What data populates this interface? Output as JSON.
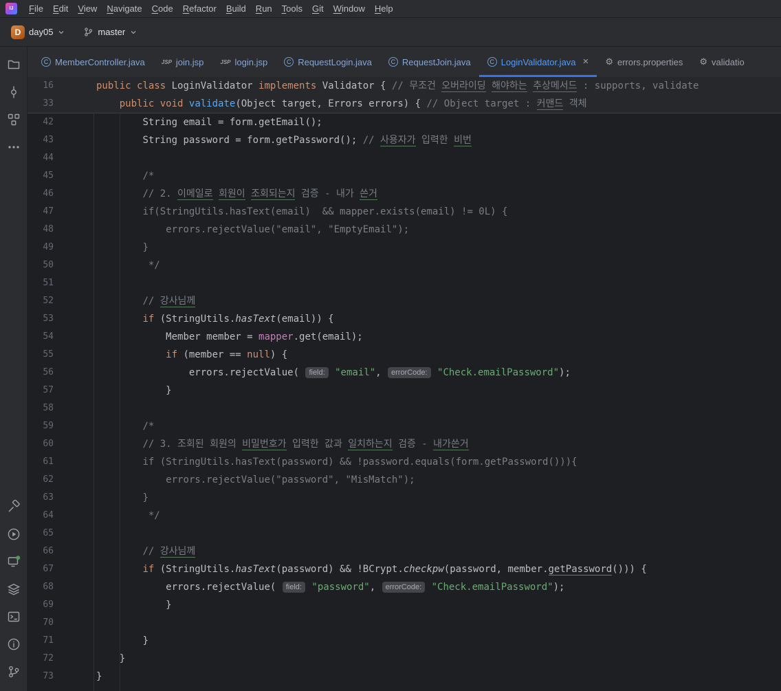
{
  "app": {
    "title": "IntelliJ IDEA",
    "logo_text": "IJ"
  },
  "colors": {
    "editor_bg": "#1e1f22",
    "panel_bg": "#2b2d30",
    "accent_blue": "#3574f0",
    "keyword": "#cf8e6d",
    "string": "#6aab73",
    "comment": "#7a7e85",
    "field": "#c77dbb",
    "method_decl": "#56a8f5",
    "typo_underline": "#567a5b"
  },
  "menu": {
    "items": [
      "File",
      "Edit",
      "View",
      "Navigate",
      "Code",
      "Refactor",
      "Build",
      "Run",
      "Tools",
      "Git",
      "Window",
      "Help"
    ]
  },
  "toolbar": {
    "project_avatar": "D",
    "project_name": "day05",
    "branch_name": "master"
  },
  "tabs": [
    {
      "label": "MemberController.java",
      "icon": "class-icon",
      "modified": true
    },
    {
      "label": "join.jsp",
      "icon": "jsp-icon",
      "modified": true
    },
    {
      "label": "login.jsp",
      "icon": "jsp-icon",
      "modified": true
    },
    {
      "label": "RequestLogin.java",
      "icon": "class-icon",
      "modified": true
    },
    {
      "label": "RequestJoin.java",
      "icon": "class-icon",
      "modified": true
    },
    {
      "label": "LoginValidator.java",
      "icon": "class-icon",
      "modified": true,
      "active": true,
      "close": "×"
    },
    {
      "label": "errors.properties",
      "icon": "gear-icon",
      "modified": false
    },
    {
      "label": "validatio",
      "icon": "gear-icon",
      "modified": false
    }
  ],
  "sidebar": {
    "top": [
      {
        "name": "project-folder-icon"
      },
      {
        "name": "commit-icon"
      },
      {
        "name": "structure-icon"
      },
      {
        "name": "more-icon"
      }
    ],
    "bottom": [
      {
        "name": "build-icon"
      },
      {
        "name": "run-icon"
      },
      {
        "name": "services-icon"
      },
      {
        "name": "layers-icon"
      },
      {
        "name": "terminal-icon"
      },
      {
        "name": "problems-icon"
      },
      {
        "name": "version-control-icon"
      }
    ]
  },
  "editor": {
    "sticky_lines": [
      {
        "n": 16,
        "i": 0,
        "p": [
          [
            "k",
            "public"
          ],
          [
            "d",
            " "
          ],
          [
            "k",
            "class"
          ],
          [
            "d",
            " LoginValidator "
          ],
          [
            "k",
            "implements"
          ],
          [
            "d",
            " Validator { "
          ],
          [
            "c",
            "// 무조건 "
          ],
          [
            "cu",
            "오버라이딩"
          ],
          [
            "c",
            " "
          ],
          [
            "cu",
            "해야하는"
          ],
          [
            "c",
            " "
          ],
          [
            "cu",
            "추상메서드"
          ],
          [
            "c",
            " : supports, validate"
          ]
        ]
      },
      {
        "n": 33,
        "i": 4,
        "p": [
          [
            "k",
            "public"
          ],
          [
            "d",
            " "
          ],
          [
            "k",
            "void"
          ],
          [
            "d",
            " "
          ],
          [
            "m",
            "validate"
          ],
          [
            "d",
            "(Object target, Errors errors) { "
          ],
          [
            "c",
            "// Object target : "
          ],
          [
            "cu",
            "커맨드"
          ],
          [
            "c",
            " 객체"
          ]
        ]
      }
    ],
    "lines": [
      {
        "n": 42,
        "i": 8,
        "p": [
          [
            "d",
            "String email = form.getEmail();"
          ]
        ]
      },
      {
        "n": 43,
        "i": 8,
        "p": [
          [
            "d",
            "String password = form.getPassword(); "
          ],
          [
            "c",
            "// "
          ],
          [
            "cu",
            "사용자가"
          ],
          [
            "c",
            " 입력한 "
          ],
          [
            "cu",
            "비번"
          ]
        ]
      },
      {
        "n": 44,
        "i": 0,
        "p": []
      },
      {
        "n": 45,
        "i": 8,
        "p": [
          [
            "c",
            "/*"
          ]
        ]
      },
      {
        "n": 46,
        "i": 8,
        "p": [
          [
            "c",
            "// 2. "
          ],
          [
            "cu",
            "이메일로"
          ],
          [
            "c",
            " "
          ],
          [
            "cu",
            "회원이"
          ],
          [
            "c",
            " "
          ],
          [
            "cu",
            "조회되는지"
          ],
          [
            "c",
            " 검증 - 내가 "
          ],
          [
            "cu",
            "쓴거"
          ]
        ]
      },
      {
        "n": 47,
        "i": 8,
        "p": [
          [
            "c",
            "if(StringUtils.hasText(email)  && mapper.exists(email) != 0L) {"
          ]
        ]
      },
      {
        "n": 48,
        "i": 12,
        "p": [
          [
            "c",
            "errors.rejectValue(\"email\", \"EmptyEmail\");"
          ]
        ]
      },
      {
        "n": 49,
        "i": 8,
        "p": [
          [
            "c",
            "}"
          ]
        ]
      },
      {
        "n": 50,
        "i": 9,
        "p": [
          [
            "c",
            "*/"
          ]
        ]
      },
      {
        "n": 51,
        "i": 0,
        "p": []
      },
      {
        "n": 52,
        "i": 8,
        "p": [
          [
            "c",
            "// "
          ],
          [
            "cu",
            "강사님께"
          ]
        ]
      },
      {
        "n": 53,
        "i": 8,
        "p": [
          [
            "k",
            "if"
          ],
          [
            "d",
            " (StringUtils."
          ],
          [
            "it",
            "hasText"
          ],
          [
            "d",
            "(email)) {"
          ]
        ]
      },
      {
        "n": 54,
        "i": 12,
        "p": [
          [
            "d",
            "Member member = "
          ],
          [
            "f",
            "mapper"
          ],
          [
            "d",
            ".get(email);"
          ]
        ]
      },
      {
        "n": 55,
        "i": 12,
        "p": [
          [
            "k",
            "if"
          ],
          [
            "d",
            " (member == "
          ],
          [
            "k",
            "null"
          ],
          [
            "d",
            ") {"
          ]
        ]
      },
      {
        "n": 56,
        "i": 16,
        "p": [
          [
            "d",
            "errors.rejectValue( "
          ],
          [
            "h",
            "field:"
          ],
          [
            "d",
            " "
          ],
          [
            "s",
            "\"email\""
          ],
          [
            "d",
            ", "
          ],
          [
            "h",
            "errorCode:"
          ],
          [
            "d",
            " "
          ],
          [
            "s",
            "\"Check.emailPassword\""
          ],
          [
            "d",
            ");"
          ]
        ]
      },
      {
        "n": 57,
        "i": 12,
        "p": [
          [
            "d",
            "}"
          ]
        ]
      },
      {
        "n": 58,
        "i": 0,
        "p": []
      },
      {
        "n": 59,
        "i": 8,
        "p": [
          [
            "c",
            "/*"
          ]
        ]
      },
      {
        "n": 60,
        "i": 8,
        "p": [
          [
            "c",
            "// 3. 조회된 회원의 "
          ],
          [
            "cu",
            "비밀번호가"
          ],
          [
            "c",
            " 입력한 값과 "
          ],
          [
            "cu",
            "일치하는지"
          ],
          [
            "c",
            " 검증 - "
          ],
          [
            "cu",
            "내가쓴거"
          ]
        ]
      },
      {
        "n": 61,
        "i": 8,
        "p": [
          [
            "c",
            "if (StringUtils.hasText(password) && !password.equals(form.getPassword())){"
          ]
        ]
      },
      {
        "n": 62,
        "i": 12,
        "p": [
          [
            "c",
            "errors.rejectValue(\"password\", \"MisMatch\");"
          ]
        ]
      },
      {
        "n": 63,
        "i": 8,
        "p": [
          [
            "c",
            "}"
          ]
        ]
      },
      {
        "n": 64,
        "i": 9,
        "p": [
          [
            "c",
            "*/"
          ]
        ]
      },
      {
        "n": 65,
        "i": 0,
        "p": []
      },
      {
        "n": 66,
        "i": 8,
        "p": [
          [
            "c",
            "// "
          ],
          [
            "cu",
            "강사님께"
          ]
        ]
      },
      {
        "n": 67,
        "i": 8,
        "p": [
          [
            "k",
            "if"
          ],
          [
            "d",
            " (StringUtils."
          ],
          [
            "it",
            "hasText"
          ],
          [
            "d",
            "(password) && !BCrypt."
          ],
          [
            "it",
            "checkpw"
          ],
          [
            "d",
            "(password, member."
          ],
          [
            "w",
            "getPassword"
          ],
          [
            "d",
            "())) {"
          ]
        ]
      },
      {
        "n": 68,
        "i": 12,
        "p": [
          [
            "d",
            "errors.rejectValue( "
          ],
          [
            "h",
            "field:"
          ],
          [
            "d",
            " "
          ],
          [
            "s",
            "\"password\""
          ],
          [
            "d",
            ", "
          ],
          [
            "h",
            "errorCode:"
          ],
          [
            "d",
            " "
          ],
          [
            "s",
            "\"Check.emailPassword\""
          ],
          [
            "d",
            ");"
          ]
        ]
      },
      {
        "n": 69,
        "i": 12,
        "p": [
          [
            "d",
            "}"
          ]
        ]
      },
      {
        "n": 70,
        "i": 0,
        "p": []
      },
      {
        "n": 71,
        "i": 8,
        "p": [
          [
            "d",
            "}"
          ]
        ]
      },
      {
        "n": 72,
        "i": 4,
        "p": [
          [
            "d",
            "}"
          ]
        ]
      },
      {
        "n": 73,
        "i": 0,
        "p": [
          [
            "d",
            "}"
          ]
        ]
      }
    ]
  }
}
